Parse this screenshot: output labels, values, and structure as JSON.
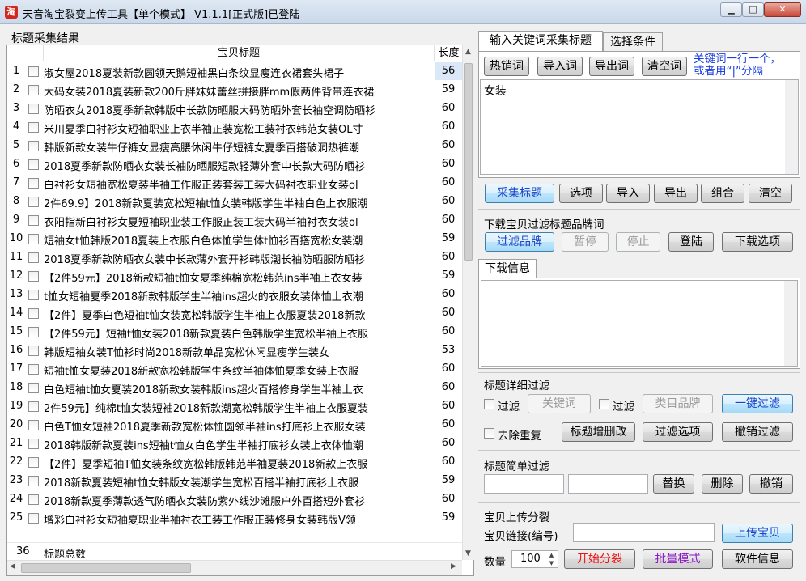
{
  "window": {
    "title": "天音淘宝裂变上传工具【单个模式】 V1.1.1[正式版]已登陆",
    "controls": {
      "minimize": "▁",
      "maximize": "□",
      "close": "✕"
    }
  },
  "left_panel": {
    "caption": "标题采集结果",
    "columns": {
      "title": "宝贝标题",
      "length": "长度"
    },
    "rows": [
      {
        "n": "1",
        "title": "淑女屋2018夏装新款圆领天鹅短袖黑白条纹显瘦连衣裙套头裙子",
        "len": "56"
      },
      {
        "n": "2",
        "title": "大码女装2018夏装新款200斤胖妹妹蕾丝拼接胖mm假两件背带连衣裙",
        "len": "59"
      },
      {
        "n": "3",
        "title": "防晒衣女2018夏季新款韩版中长款防晒服大码防晒外套长袖空调防晒衫",
        "len": "60"
      },
      {
        "n": "4",
        "title": "米川夏季白衬衫女短袖职业上衣半袖正装宽松工装衬衣韩范女装OL寸",
        "len": "60"
      },
      {
        "n": "5",
        "title": "韩版新款女装牛仔裤女显瘦高腰休闲牛仔短裤女夏季百搭破洞热裤潮",
        "len": "60"
      },
      {
        "n": "6",
        "title": "2018夏季新款防晒衣女装长袖防晒服短款轻薄外套中长款大码防晒衫",
        "len": "60"
      },
      {
        "n": "7",
        "title": "白衬衫女短袖宽松夏装半袖工作服正装套装工装大码衬衣职业女装ol",
        "len": "60"
      },
      {
        "n": "8",
        "title": "2件69.9】2018新款夏装宽松短袖t恤女装韩版学生半袖白色上衣服潮",
        "len": "60"
      },
      {
        "n": "9",
        "title": "衣阳指新白衬衫女夏短袖职业装工作服正装工装大码半袖衬衣女装ol",
        "len": "60"
      },
      {
        "n": "10",
        "title": "短袖女t恤韩版2018夏装上衣服白色体恤学生体t恤衫百搭宽松女装潮",
        "len": "59"
      },
      {
        "n": "11",
        "title": "2018夏季新款防晒衣女装中长款薄外套开衫韩版潮长袖防晒服防晒衫",
        "len": "60"
      },
      {
        "n": "12",
        "title": "【2件59元】2018新款短袖t恤女夏季纯棉宽松韩范ins半袖上衣女装",
        "len": "59"
      },
      {
        "n": "13",
        "title": "t恤女短袖夏季2018新款韩版学生半袖ins超火的衣服女装体恤上衣潮",
        "len": "60"
      },
      {
        "n": "14",
        "title": "【2件】夏季白色短袖t恤女装宽松韩版学生半袖上衣服夏装2018新款",
        "len": "60"
      },
      {
        "n": "15",
        "title": "【2件59元】短袖t恤女装2018新款夏装白色韩版学生宽松半袖上衣服",
        "len": "60"
      },
      {
        "n": "16",
        "title": "韩版短袖女装T恤衫时尚2018新款单品宽松休闲显瘦学生装女",
        "len": "53"
      },
      {
        "n": "17",
        "title": "短袖t恤女夏装2018新款宽松韩版学生条纹半袖体恤夏季女装上衣服",
        "len": "60"
      },
      {
        "n": "18",
        "title": "白色短袖t恤女夏装2018新款女装韩版ins超火百搭修身学生半袖上衣",
        "len": "60"
      },
      {
        "n": "19",
        "title": "2件59元】纯棉t恤女装短袖2018新款潮宽松韩版学生半袖上衣服夏装",
        "len": "60"
      },
      {
        "n": "20",
        "title": "白色T恤女短袖2018夏季新款宽松体恤圆领半袖ins打底衫上衣服女装",
        "len": "60"
      },
      {
        "n": "21",
        "title": "2018韩版新款夏装ins短袖t恤女白色学生半袖打底衫女装上衣体恤潮",
        "len": "60"
      },
      {
        "n": "22",
        "title": "【2件】夏季短袖T恤女装条纹宽松韩版韩范半袖夏装2018新款上衣服",
        "len": "60"
      },
      {
        "n": "23",
        "title": "2018新款夏装短袖t恤女韩版女装潮学生宽松百搭半袖打底衫上衣服",
        "len": "59"
      },
      {
        "n": "24",
        "title": "2018新款夏季薄款透气防晒衣女装防紫外线沙滩服户外百搭短外套衫",
        "len": "60"
      },
      {
        "n": "25",
        "title": "增彩白衬衫女短袖夏职业半袖衬衣工装工作服正装修身女装韩版V领",
        "len": "59"
      }
    ],
    "total": {
      "count": "36",
      "label": "标题总数"
    }
  },
  "keyword_panel": {
    "tabs": [
      "输入关键词采集标题",
      "选择条件"
    ],
    "buttons": {
      "hot": "热销词",
      "import": "导入词",
      "export": "导出词",
      "clear": "清空词"
    },
    "hint_line1": "关键词一行一个，",
    "hint_line2": "或者用“|”分隔",
    "keywords_value": "女装"
  },
  "action_bar": {
    "collect": "采集标题",
    "options": "选项",
    "import": "导入",
    "export": "导出",
    "combine": "组合",
    "clear": "清空"
  },
  "download_filter": {
    "section": "下载宝贝过滤标题品牌词",
    "filter_brand": "过滤品牌",
    "pause": "暂停",
    "stop": "停止",
    "login": "登陆",
    "download_options": "下载选项",
    "info_tab": "下载信息"
  },
  "title_filter": {
    "section": "标题详细过滤",
    "filter1_label": "过滤",
    "keyword_btn": "关键词",
    "filter2_label": "过滤",
    "category_btn": "类目品牌",
    "one_click": "一键过滤",
    "dedupe_label": "去除重复",
    "add_remove": "标题增删改",
    "filter_options": "过滤选项",
    "undo": "撤销过滤"
  },
  "simple_filter": {
    "section": "标题简单过滤",
    "replace": "替换",
    "delete": "删除",
    "undo": "撤销"
  },
  "upload": {
    "section": "宝贝上传分裂",
    "link_label": "宝贝链接(编号)",
    "upload_btn": "上传宝贝",
    "qty_label": "数量",
    "qty_value": "100",
    "start": "开始分裂",
    "batch": "批量模式",
    "info": "软件信息"
  }
}
